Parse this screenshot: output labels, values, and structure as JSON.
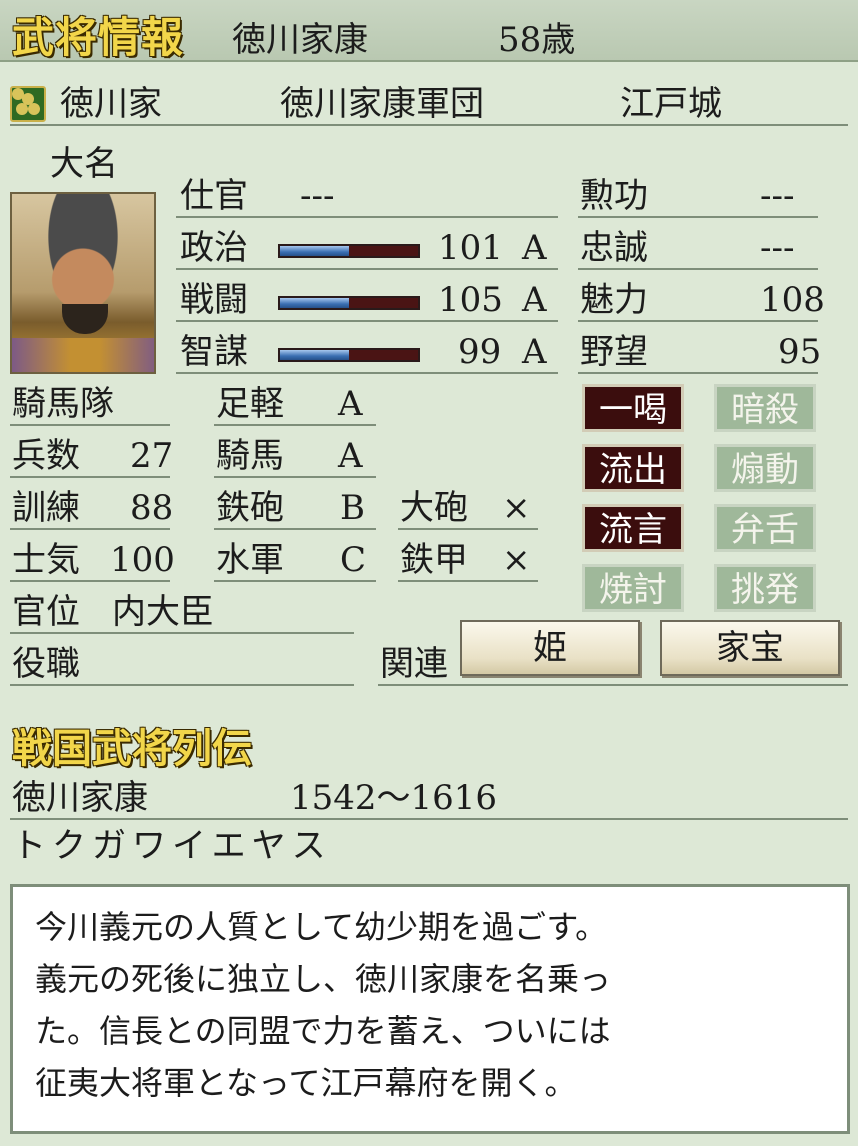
{
  "header": {
    "title": "武将情報",
    "name": "徳川家康",
    "age": "58歳"
  },
  "affiliation": {
    "clan": "徳川家",
    "corps": "徳川家康軍団",
    "castle": "江戸城"
  },
  "rank": "大名",
  "service": {
    "label": "仕官",
    "value": "---"
  },
  "stats": [
    {
      "label": "政治",
      "value": "101",
      "grade": "A",
      "fill": 0.5
    },
    {
      "label": "戦闘",
      "value": "105",
      "grade": "A",
      "fill": 0.5
    },
    {
      "label": "智謀",
      "value": "99",
      "grade": "A",
      "fill": 0.5
    }
  ],
  "right_stats": [
    {
      "label": "勲功",
      "value": "---"
    },
    {
      "label": "忠誠",
      "value": "---"
    },
    {
      "label": "魅力",
      "value": "108"
    },
    {
      "label": "野望",
      "value": "95"
    }
  ],
  "unit": {
    "type": "騎馬隊"
  },
  "troops": [
    {
      "label": "兵数",
      "value": "27"
    },
    {
      "label": "訓練",
      "value": "88"
    },
    {
      "label": "士気",
      "value": "100"
    }
  ],
  "aptitudes": [
    {
      "label": "足軽",
      "value": "A"
    },
    {
      "label": "騎馬",
      "value": "A"
    },
    {
      "label": "鉄砲",
      "value": "B"
    },
    {
      "label": "水軍",
      "value": "C"
    }
  ],
  "equipment": [
    {
      "label": "大砲",
      "value": "×"
    },
    {
      "label": "鉄甲",
      "value": "×"
    }
  ],
  "commands": [
    {
      "label": "一喝",
      "state": "on"
    },
    {
      "label": "暗殺",
      "state": "off"
    },
    {
      "label": "流出",
      "state": "on"
    },
    {
      "label": "煽動",
      "state": "off"
    },
    {
      "label": "流言",
      "state": "on"
    },
    {
      "label": "弁舌",
      "state": "off"
    },
    {
      "label": "焼討",
      "state": "off"
    },
    {
      "label": "挑発",
      "state": "off"
    }
  ],
  "court_rank": {
    "label": "官位",
    "value": "内大臣"
  },
  "post": {
    "label": "役職"
  },
  "related": {
    "label": "関連",
    "btn_princess": "姫",
    "btn_treasure": "家宝"
  },
  "biography": {
    "title": "戦国武将列伝",
    "name": "徳川家康",
    "years": "1542〜1616",
    "reading": "トクガワイエヤス",
    "lines": [
      "今川義元の人質として幼少期を過ごす。",
      "義元の死後に独立し、徳川家康を名乗っ",
      "た。信長との同盟で力を蓄え、ついには",
      "征夷大将軍となって江戸幕府を開く。"
    ]
  },
  "colors": {
    "title_gold": "#f2d64a",
    "bar_blue": "#3b6fb2",
    "bar_track": "#4a1414",
    "cmd_on": "#3b0d0d",
    "cmd_off": "#9fb89a"
  }
}
